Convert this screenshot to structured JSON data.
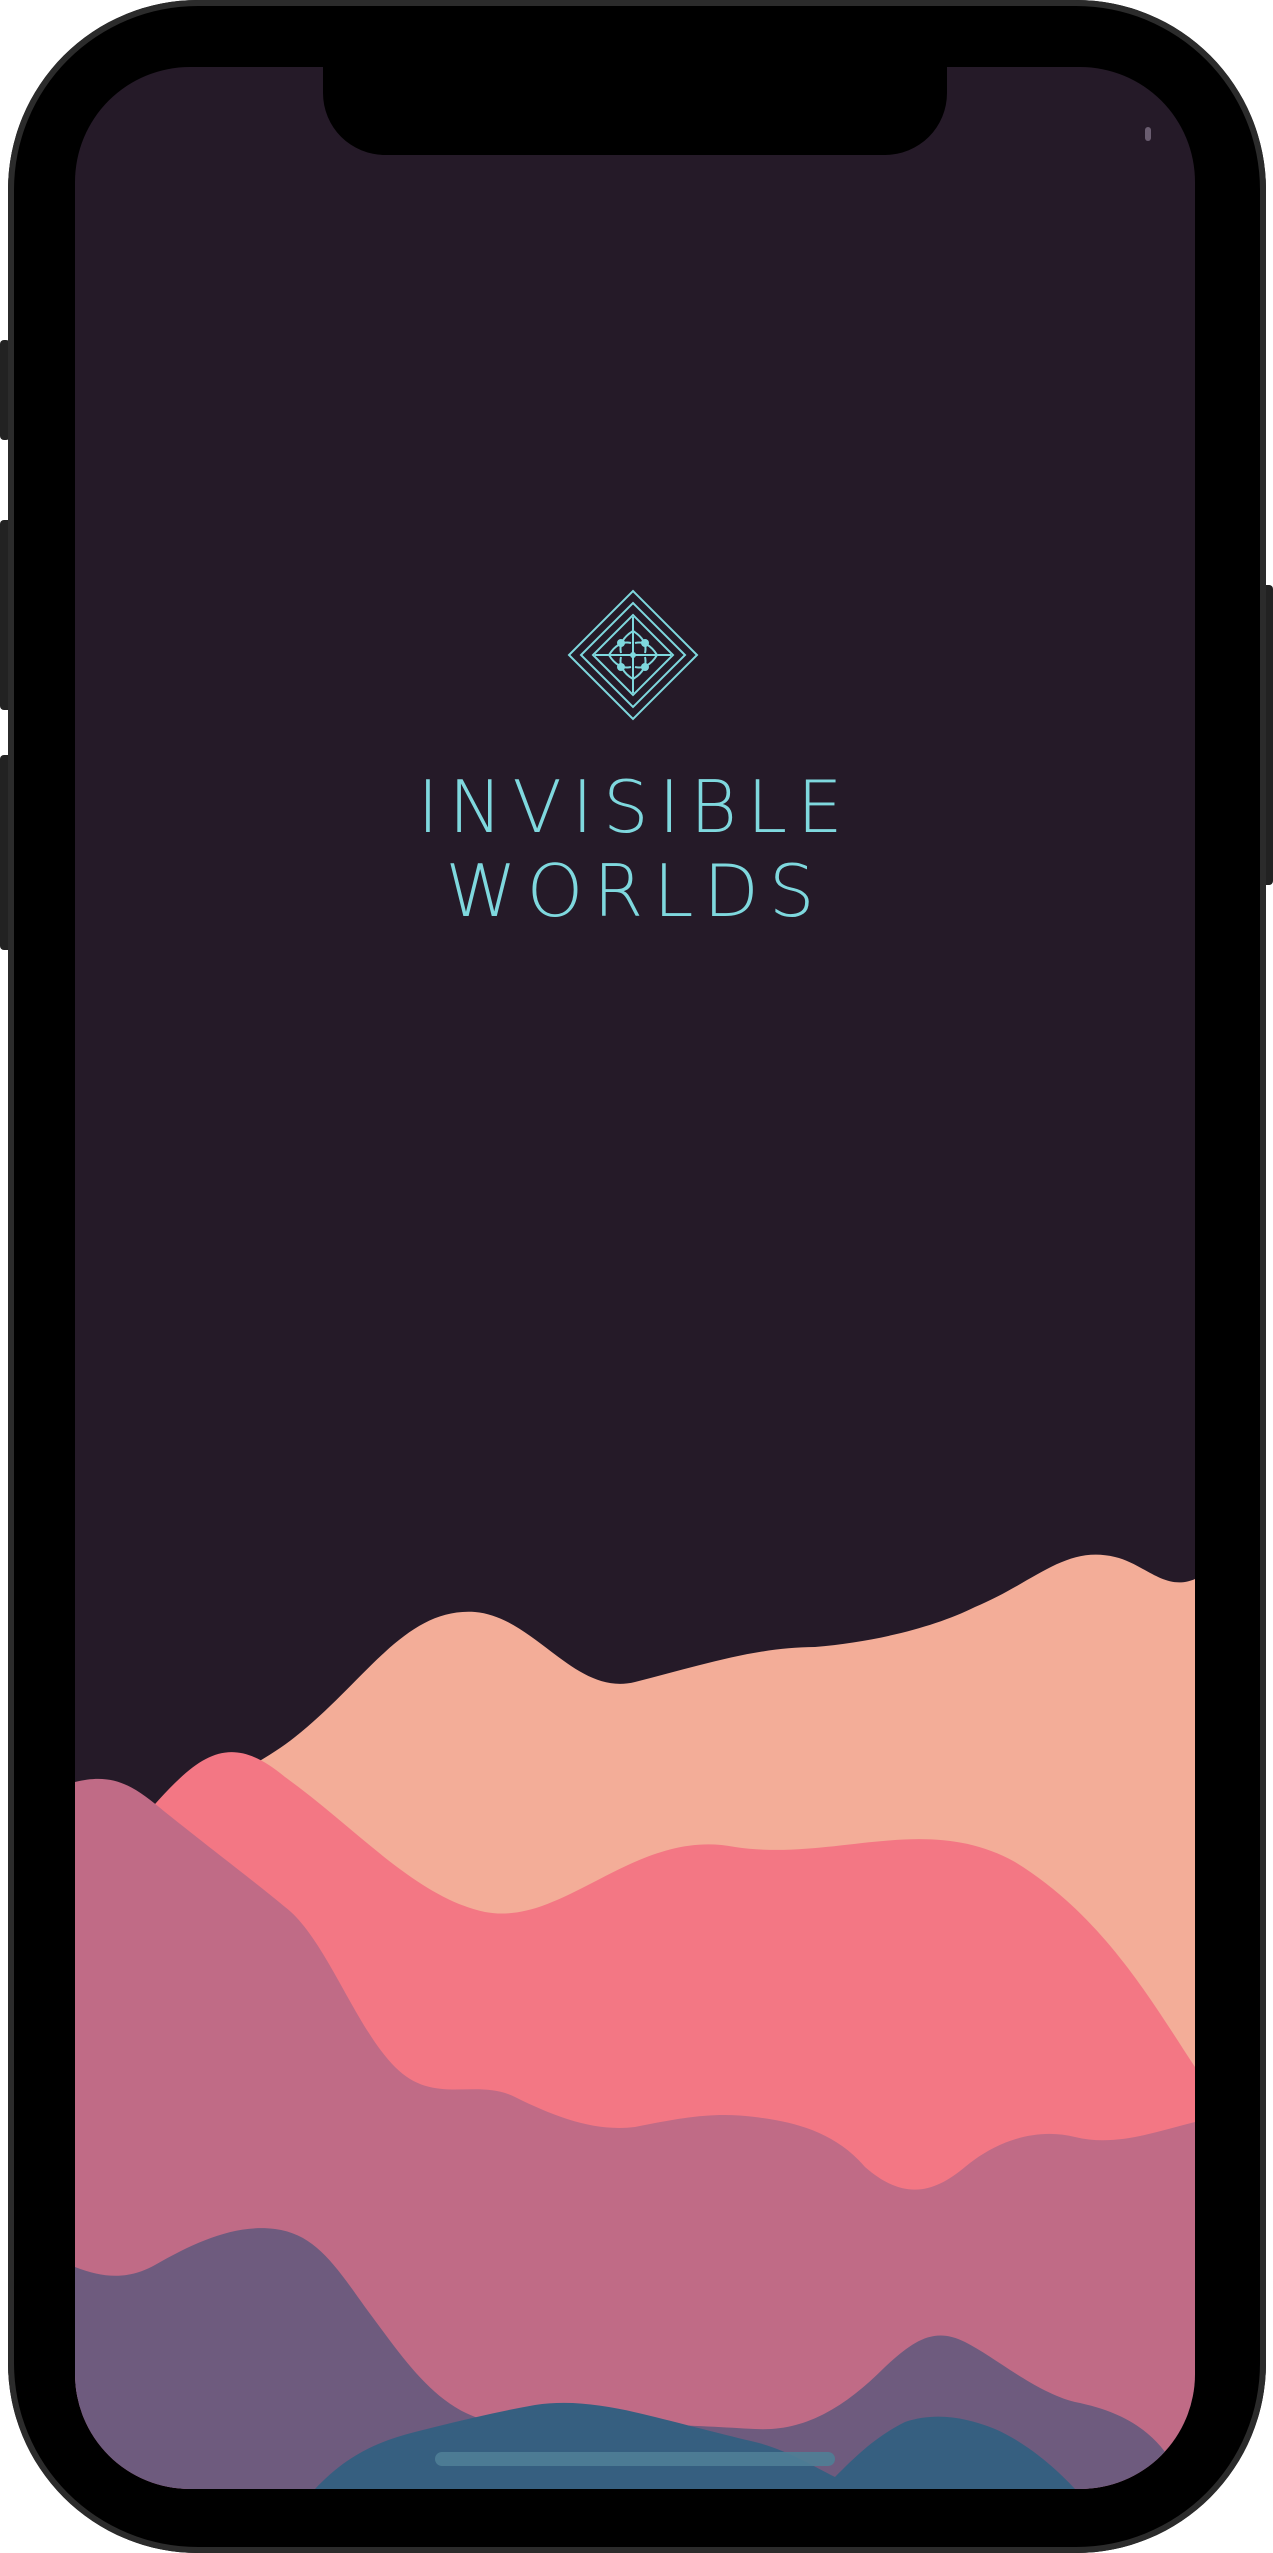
{
  "app": {
    "title_line1": "INVISIBLE",
    "title_line2": "WORLDS"
  },
  "colors": {
    "background": "#251a28",
    "accent": "#7fd8de",
    "hill_peach": "#f3ad98",
    "hill_coral": "#f37784",
    "hill_rose": "#c06b86",
    "hill_purple": "#6e5b7e",
    "hill_blue": "#365f80"
  },
  "icons": {
    "logo": "diamond-ornament-icon"
  }
}
